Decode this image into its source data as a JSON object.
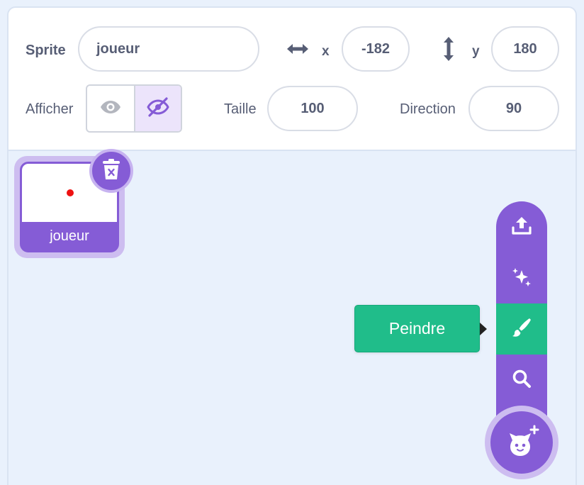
{
  "sprite_info": {
    "sprite_label": "Sprite",
    "sprite_name": "joueur",
    "x_label": "x",
    "x_value": "-182",
    "y_label": "y",
    "y_value": "180",
    "show_label": "Afficher",
    "show_icon": "eye-icon",
    "hide_icon": "eye-slash-icon",
    "hidden_selected": true,
    "size_label": "Taille",
    "size_value": "100",
    "direction_label": "Direction",
    "direction_value": "90"
  },
  "sprites": [
    {
      "name": "joueur",
      "selected": true,
      "delete_icon": "trash-icon"
    }
  ],
  "add_sprite_menu": {
    "items": [
      {
        "name": "upload",
        "icon": "upload-icon"
      },
      {
        "name": "surprise",
        "icon": "sparkles-icon"
      },
      {
        "name": "paint",
        "icon": "paintbrush-icon",
        "active": true
      },
      {
        "name": "search",
        "icon": "search-icon"
      }
    ],
    "main_icon": "cat-plus-icon",
    "tooltip": "Peindre"
  },
  "colors": {
    "accent": "#855cd6",
    "accent_light": "#cdbdf0",
    "paint_green": "#20bd8a",
    "background": "#e9f1fc",
    "text": "#575e75"
  }
}
